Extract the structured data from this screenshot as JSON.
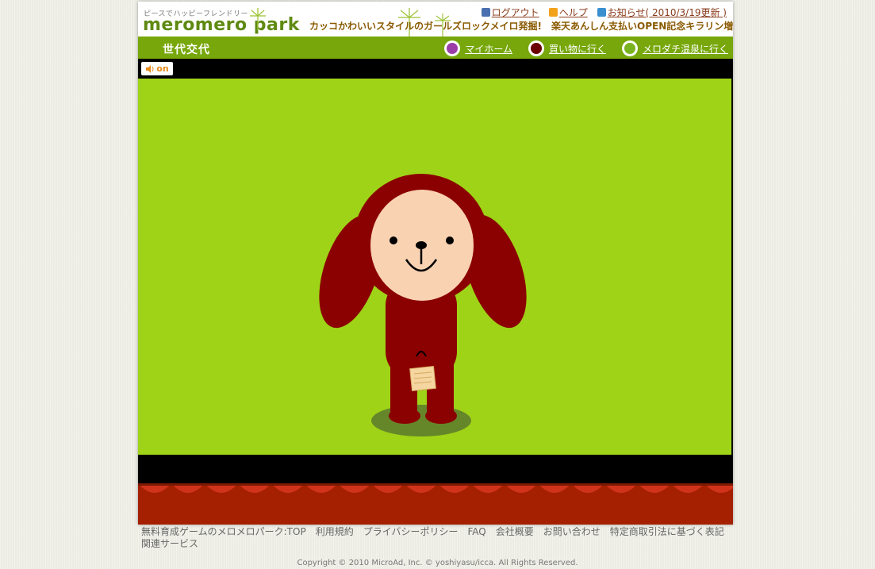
{
  "header": {
    "tagline": "ピースでハッピーフレンドリー",
    "logo": "meromero park",
    "marquee": "カッコかわいいスタイルのガールズロックメイロ発掘!　楽天あんしん支払いOPEN記念キラリン増量中!",
    "links": [
      {
        "label": "ログアウト",
        "icon": "logout-icon",
        "color": "#4a6fb0"
      },
      {
        "label": "ヘルプ",
        "icon": "help-icon",
        "color": "#f2a21b"
      },
      {
        "label": "お知らせ( 2010/3/19更新 )",
        "icon": "info-icon",
        "color": "#3a8fd0"
      }
    ]
  },
  "nav": {
    "title": "世代交代",
    "links": [
      {
        "label": "マイホーム",
        "icon": "myhome-icon",
        "color": "#9b3ea8"
      },
      {
        "label": "買い物に行く",
        "icon": "shopping-icon",
        "color": "#6b0000"
      },
      {
        "label": "メロダチ温泉に行く",
        "icon": "onsen-icon",
        "color": "#7ab320"
      }
    ]
  },
  "sound": {
    "label": "on"
  },
  "footer": {
    "links": [
      "無料育成ゲームのメロメロパーク:TOP",
      "利用規約",
      "プライバシーポリシー",
      "FAQ",
      "会社概要",
      "お問い合わせ",
      "特定商取引法に基づく表記",
      "関連サービス"
    ],
    "copyright": "Copyright © 2010 MicroAd, Inc. © yoshiyasu/icca. All Rights Reserved."
  },
  "colors": {
    "brand": "#77a70a",
    "stage": "#9fd317",
    "character": "#8b0000",
    "curtain": "#a42000"
  }
}
